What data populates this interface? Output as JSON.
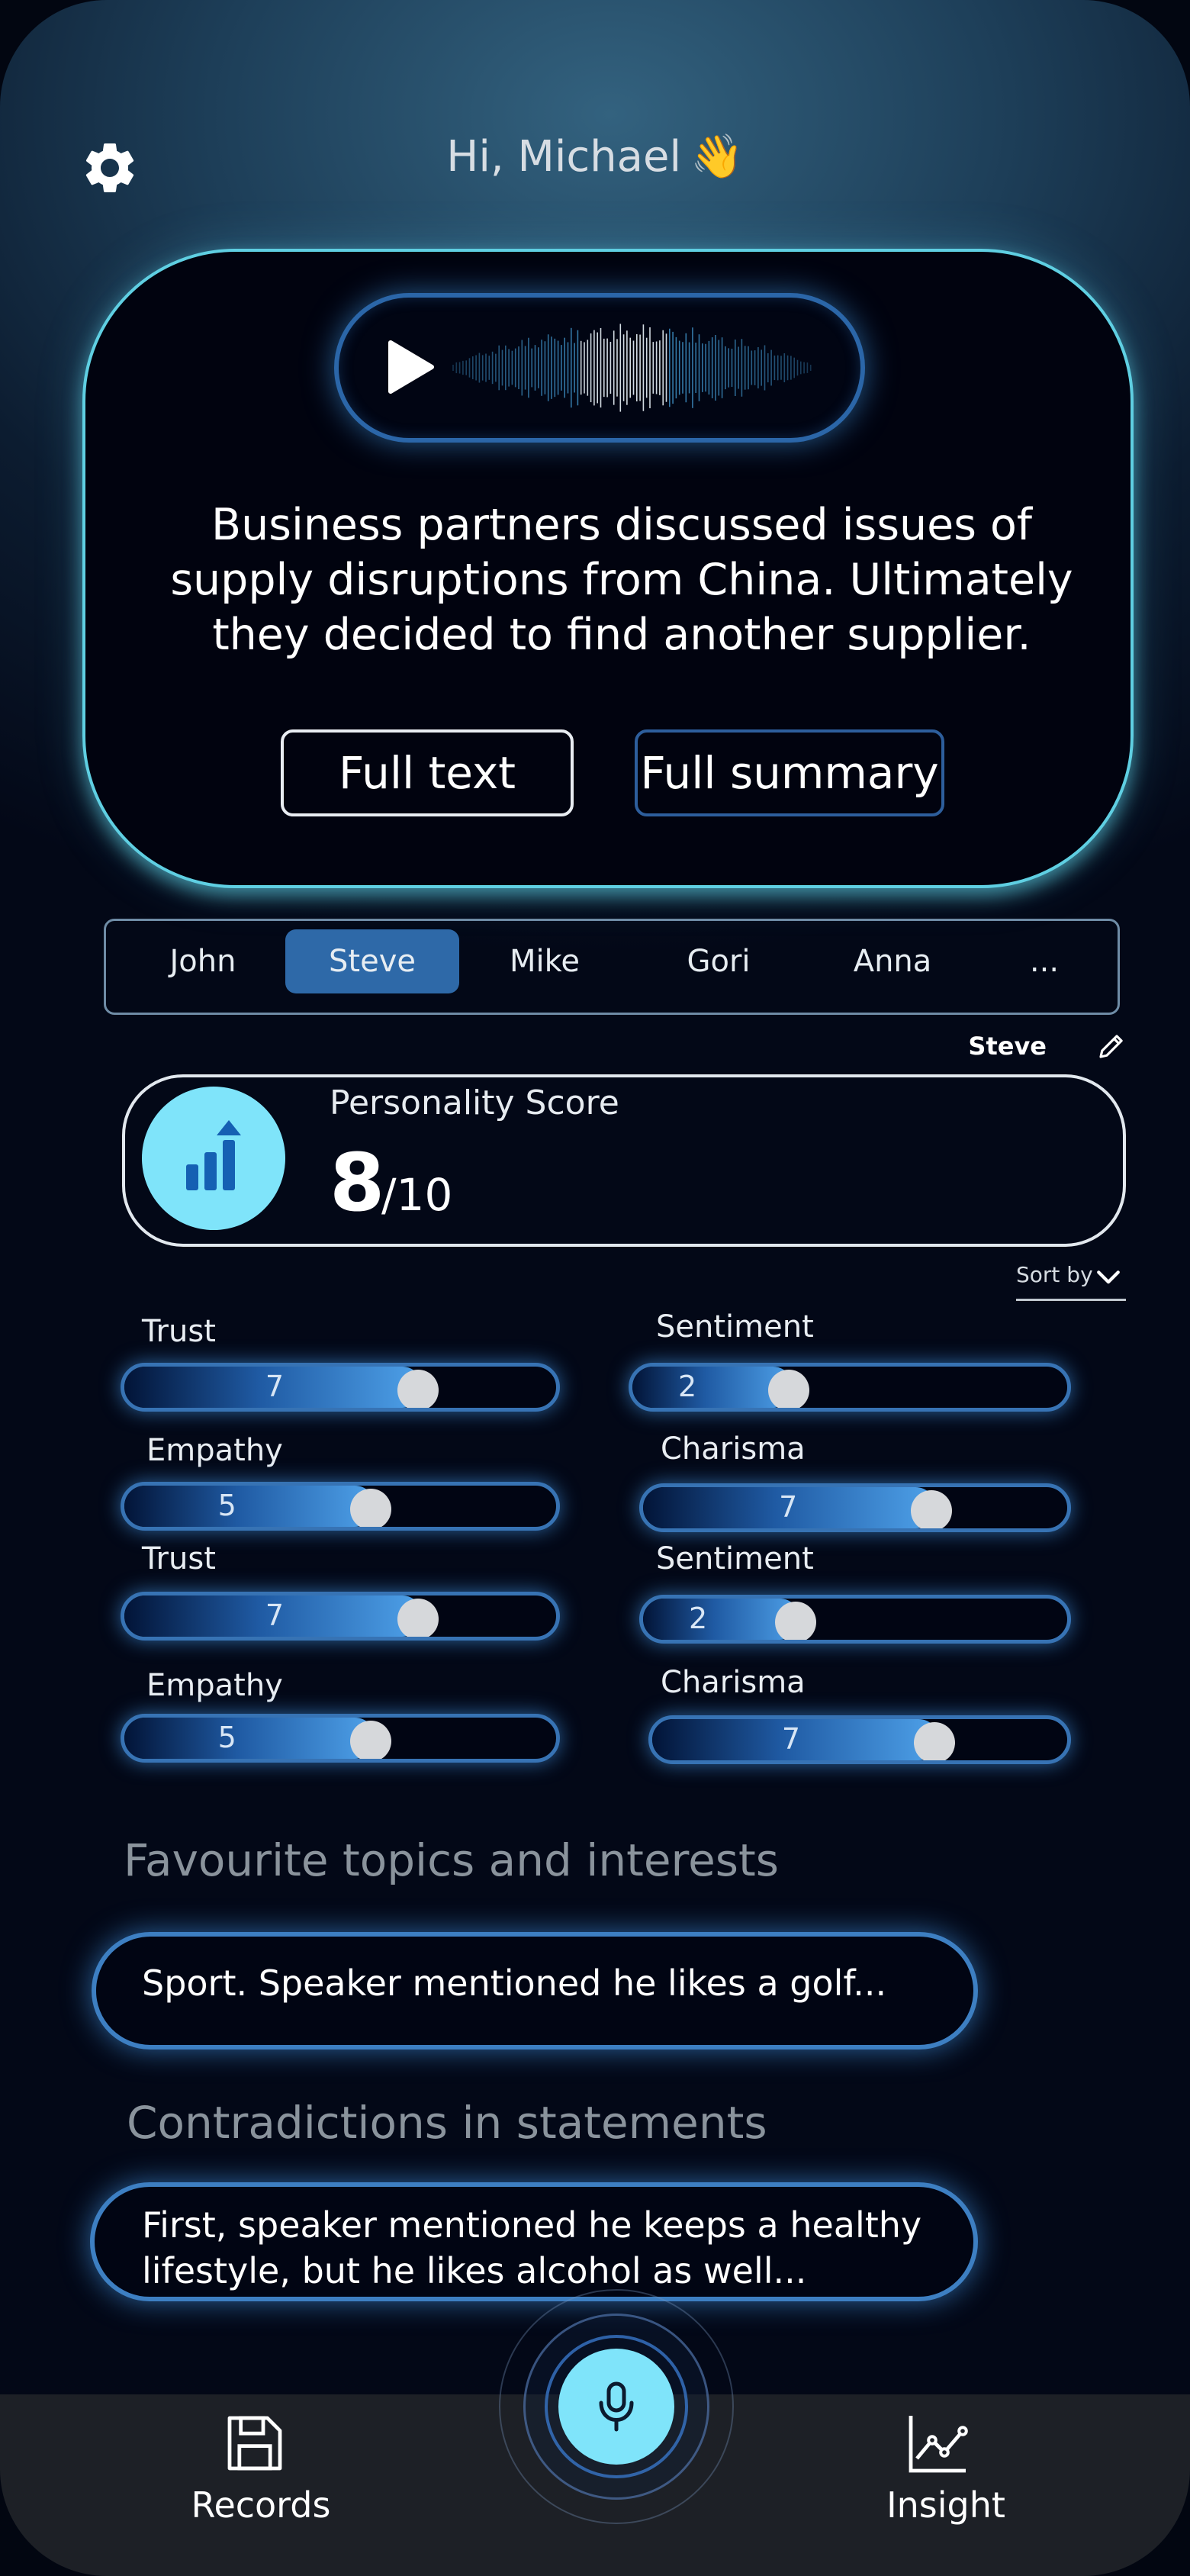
{
  "header": {
    "greeting": "Hi, Michael",
    "wave_emoji": "👋",
    "settings_icon": "gear-icon"
  },
  "summary_card": {
    "player_icon": "play-icon",
    "summary": "Business partners discussed issues of supply disruptions from China. Ultimately they decided to find another supplier.",
    "full_text_label": "Full text",
    "full_summary_label": "Full summary"
  },
  "tabs": [
    "John",
    "Steve",
    "Mike",
    "Gori",
    "Anna",
    "..."
  ],
  "active_tab": "Steve",
  "selected_speaker": "Steve",
  "personality": {
    "title": "Personality Score",
    "score": "8",
    "max": "/10"
  },
  "sort_label": "Sort by",
  "traits": [
    {
      "label": "Trust",
      "value": "7",
      "fraction": 0.68
    },
    {
      "label": "Sentiment",
      "value": "2",
      "fraction": 0.36
    },
    {
      "label": "Empathy",
      "value": "5",
      "fraction": 0.57
    },
    {
      "label": "Charisma",
      "value": "7",
      "fraction": 0.68
    },
    {
      "label": "Trust",
      "value": "7",
      "fraction": 0.68
    },
    {
      "label": "Sentiment",
      "value": "2",
      "fraction": 0.36
    },
    {
      "label": "Empathy",
      "value": "5",
      "fraction": 0.57
    },
    {
      "label": "Charisma",
      "value": "7",
      "fraction": 0.68
    }
  ],
  "topics": {
    "title": "Favourite topics and interests",
    "text": "Sport. Speaker mentioned he likes a golf..."
  },
  "contradictions": {
    "title": "Contradictions in statements",
    "line1": "First, speaker mentioned he keeps a healthy",
    "line2": "lifestyle, but he likes alcohol as well..."
  },
  "nav": {
    "records": "Records",
    "insight": "Insight"
  },
  "colors": {
    "accent_cyan": "#7fe4fa",
    "active_tab": "#2e69a8",
    "slider_border": "#3773b4"
  }
}
